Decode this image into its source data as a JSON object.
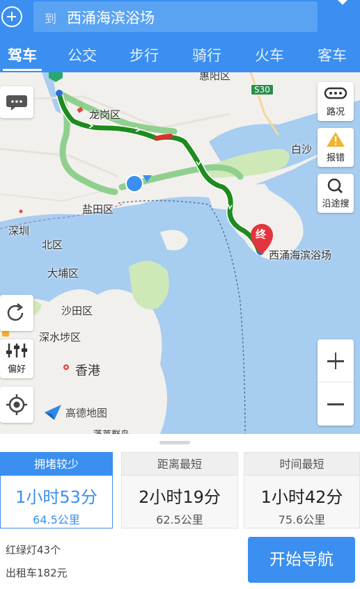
{
  "header": {
    "destination_prefix": "到",
    "destination": "西涌海滨浴场",
    "tabs": [
      {
        "label": "驾车",
        "active": true
      },
      {
        "label": "公交",
        "active": false
      },
      {
        "label": "步行",
        "active": false
      },
      {
        "label": "骑行",
        "active": false
      },
      {
        "label": "火车",
        "active": false
      },
      {
        "label": "客车",
        "active": false
      }
    ]
  },
  "map": {
    "labels": {
      "longgang": "龙岗区",
      "yantian": "盐田区",
      "shenzhen": "深圳",
      "north": "北区",
      "dapu": "大埔区",
      "shatian": "沙田区",
      "shenshuibu": "深水埗区",
      "hongkong": "香港",
      "baisha": "白沙",
      "huiyang": "惠阳区",
      "destination": "西涌海滨浴场",
      "bottom_cut": "蓬莱群岛"
    },
    "highway_badge": "S30",
    "end_marker": "终",
    "logo_text": "高德地图",
    "buttons": {
      "traffic": "路况",
      "report": "报错",
      "search_along": "沿途搜",
      "preference": "偏好"
    },
    "colors": {
      "water": "#a7cdf0",
      "land": "#f2f0ec",
      "park": "#cfe8b8",
      "route_main": "#1e8b1e",
      "route_alt": "#8fd08f",
      "accent": "#3a8ff0"
    }
  },
  "routes": [
    {
      "label": "拥堵较少",
      "time": "1小时53分",
      "distance": "64.5公里",
      "active": true
    },
    {
      "label": "距离最短",
      "time": "2小时19分",
      "distance": "62.5公里",
      "active": false
    },
    {
      "label": "时间最短",
      "time": "1小时42分",
      "distance": "75.6公里",
      "active": false
    }
  ],
  "summary": {
    "traffic_lights": "红绿灯43个",
    "taxi_fare": "出租车182元"
  },
  "start_button": "开始导航"
}
